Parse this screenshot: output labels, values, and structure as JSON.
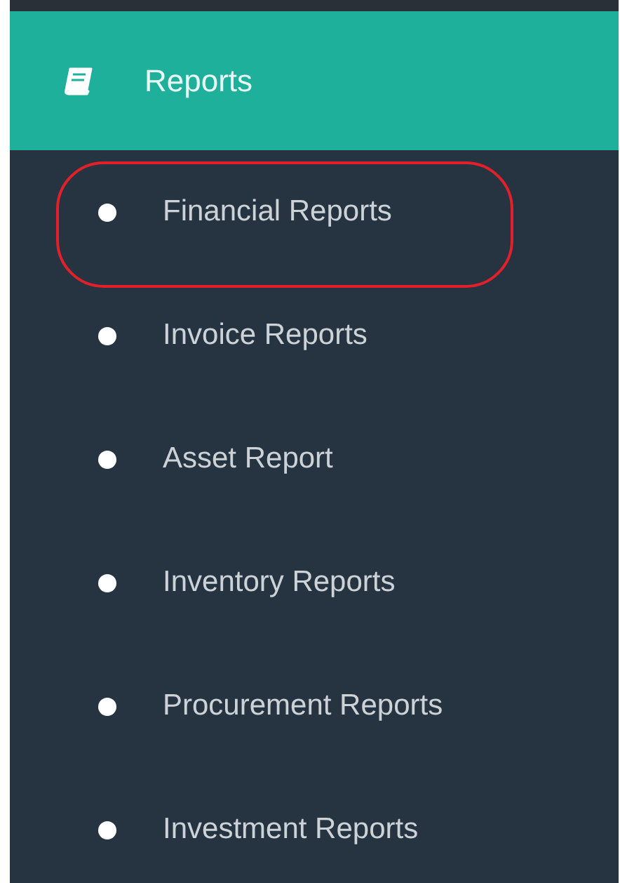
{
  "header": {
    "title": "Reports"
  },
  "menu": [
    {
      "label": "Financial Reports",
      "highlighted": true
    },
    {
      "label": "Invoice Reports",
      "highlighted": false
    },
    {
      "label": "Asset Report",
      "highlighted": false
    },
    {
      "label": "Inventory Reports",
      "highlighted": false
    },
    {
      "label": "Procurement Reports",
      "highlighted": false
    },
    {
      "label": "Investment Reports",
      "highlighted": false
    }
  ]
}
